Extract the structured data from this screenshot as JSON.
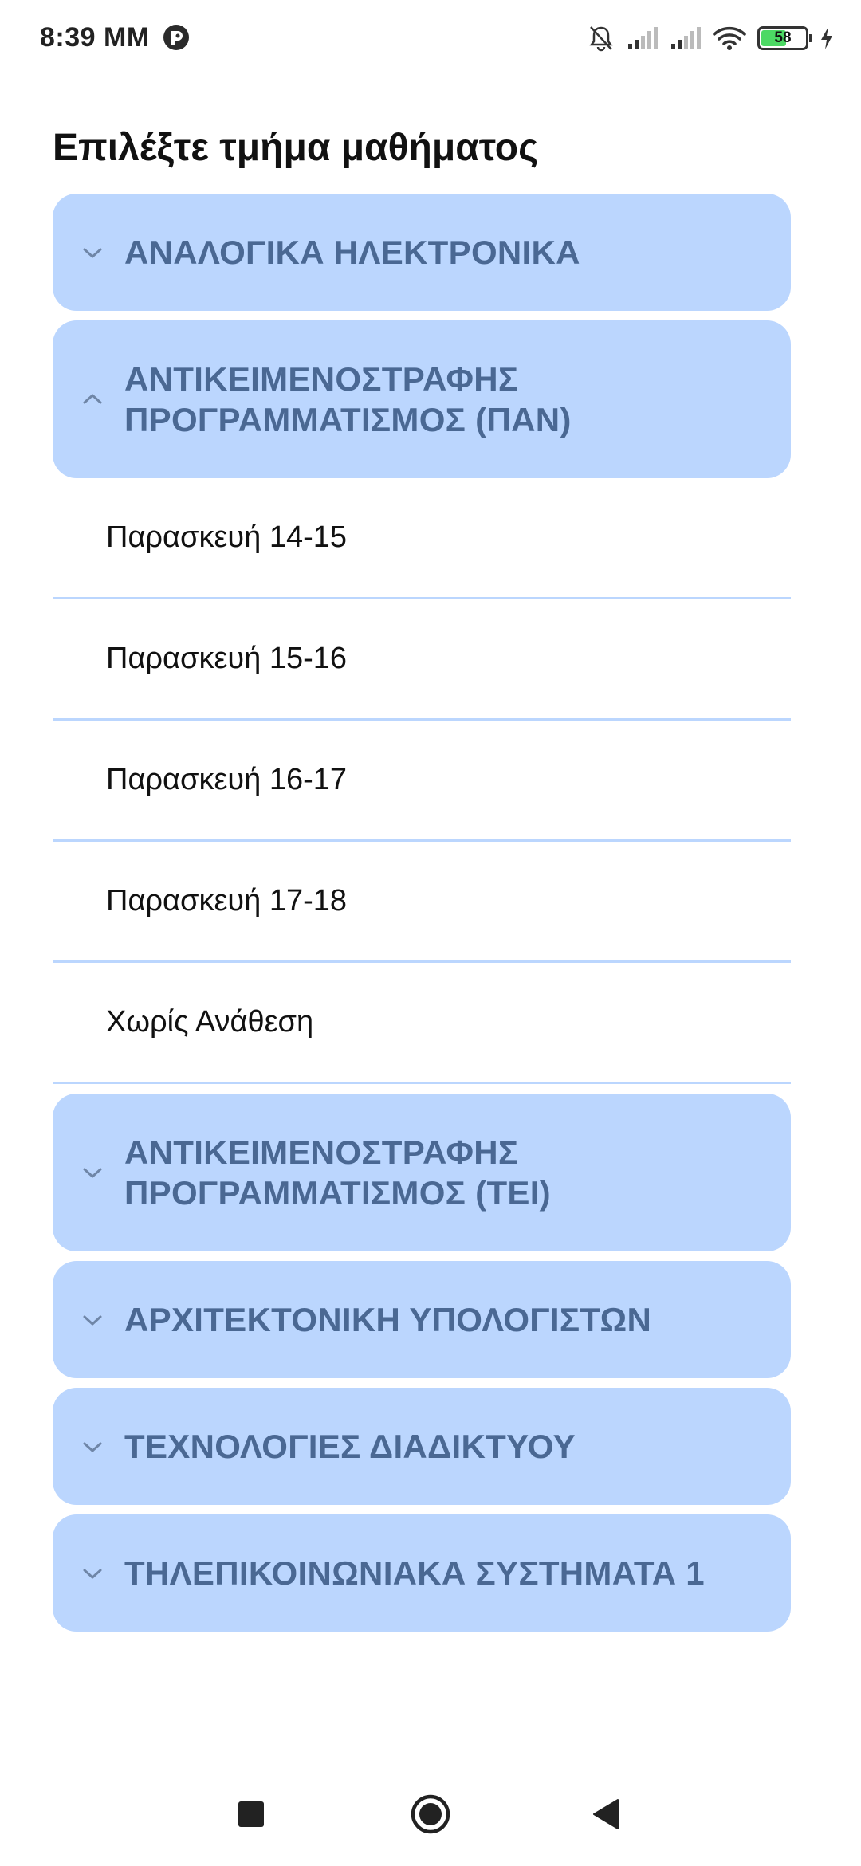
{
  "status_bar": {
    "time": "8:39 MM",
    "battery_level": "58",
    "battery_fraction": 0.58,
    "icons": [
      "app-notification-icon",
      "mute-icon",
      "signal-icon",
      "signal-icon",
      "wifi-icon",
      "battery-icon",
      "charging-icon"
    ]
  },
  "page": {
    "title": "Επιλέξτε τμήμα μαθήματος"
  },
  "sections": [
    {
      "label": "ΑΝΑΛΟΓΙΚΑ ΗΛΕΚΤΡΟΝΙΚΑ",
      "expanded": false
    },
    {
      "label_line1": "ΑΝΤΙΚΕΙΜΕΝΟΣΤΡΑΦΗΣ",
      "label_line2": "ΠΡΟΓΡΑΜΜΑΤΙΣΜΟΣ (ΠΑΝ)",
      "expanded": true,
      "items": [
        "Παρασκευή 14-15",
        "Παρασκευή 15-16",
        "Παρασκευή 16-17",
        "Παρασκευή 17-18",
        "Χωρίς Ανάθεση"
      ]
    },
    {
      "label_line1": "ΑΝΤΙΚΕΙΜΕΝΟΣΤΡΑΦΗΣ",
      "label_line2": "ΠΡΟΓΡΑΜΜΑΤΙΣΜΟΣ (ΤΕΙ)",
      "expanded": false
    },
    {
      "label": "ΑΡΧΙΤΕΚΤΟΝΙΚΗ ΥΠΟΛΟΓΙΣΤΩΝ",
      "expanded": false
    },
    {
      "label": "ΤΕΧΝΟΛΟΓΙΕΣ ΔΙΑΔΙΚΤΥΟΥ",
      "expanded": false
    },
    {
      "label": "ΤΗΛΕΠΙΚΟΙΝΩΝΙΑΚΑ ΣΥΣΤΗΜΑΤΑ 1",
      "expanded": false
    }
  ],
  "nav_bar": {
    "icons": [
      "recents-icon",
      "home-icon",
      "back-icon"
    ]
  },
  "colors": {
    "section_bg": "#bbd6fe",
    "section_text": "#4a6893",
    "divider": "#bbd6fe"
  }
}
